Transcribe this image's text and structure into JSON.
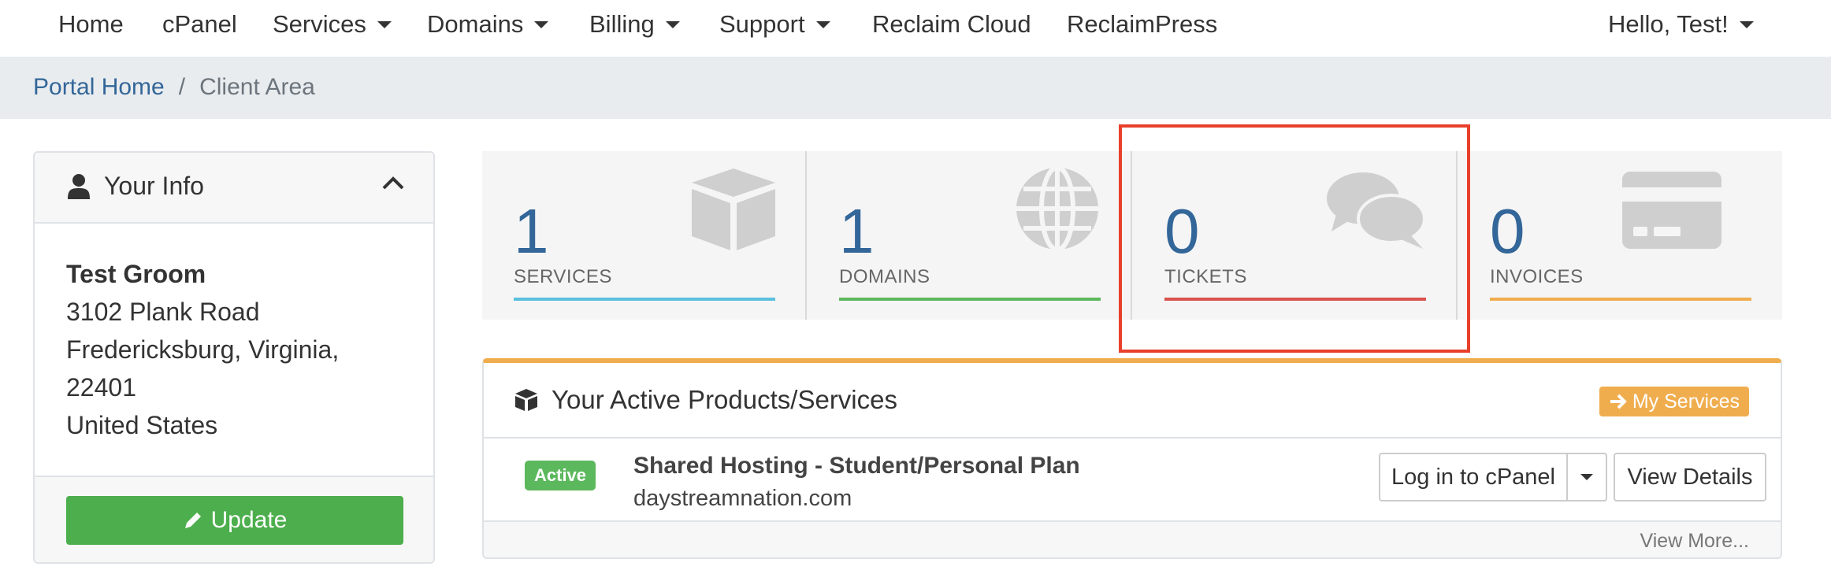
{
  "nav": {
    "home": "Home",
    "cpanel": "cPanel",
    "services": "Services",
    "domains": "Domains",
    "billing": "Billing",
    "support": "Support",
    "reclaim_cloud": "Reclaim Cloud",
    "reclaimpress": "ReclaimPress",
    "user_menu": "Hello, Test!"
  },
  "breadcrumb": {
    "home": "Portal Home",
    "separator": "/",
    "current": "Client Area"
  },
  "your_info": {
    "title": "Your Info",
    "name": "Test Groom",
    "address1": "3102 Plank Road",
    "address2": "Fredericksburg, Virginia,",
    "postcode": "22401",
    "country": "United States",
    "update_label": "Update"
  },
  "tiles": [
    {
      "count": "1",
      "label": "SERVICES",
      "color": "#5bc0de",
      "icon": "cube-icon"
    },
    {
      "count": "1",
      "label": "DOMAINS",
      "color": "#5cb85c",
      "icon": "globe-icon"
    },
    {
      "count": "0",
      "label": "TICKETS",
      "color": "#d9534f",
      "icon": "comments-icon"
    },
    {
      "count": "0",
      "label": "INVOICES",
      "color": "#f0ad4e",
      "icon": "credit-card-icon"
    }
  ],
  "products": {
    "title": "Your Active Products/Services",
    "my_services_label": "My Services",
    "status": "Active",
    "product_name": "Shared Hosting - Student/Personal Plan",
    "domain": "daystreamnation.com",
    "login_label": "Log in to cPanel",
    "view_details_label": "View Details",
    "view_more_label": "View More..."
  },
  "colors": {
    "link": "#336699",
    "highlight": "#e8402a",
    "success": "#4cae4c",
    "warning": "#f0ad4e"
  }
}
